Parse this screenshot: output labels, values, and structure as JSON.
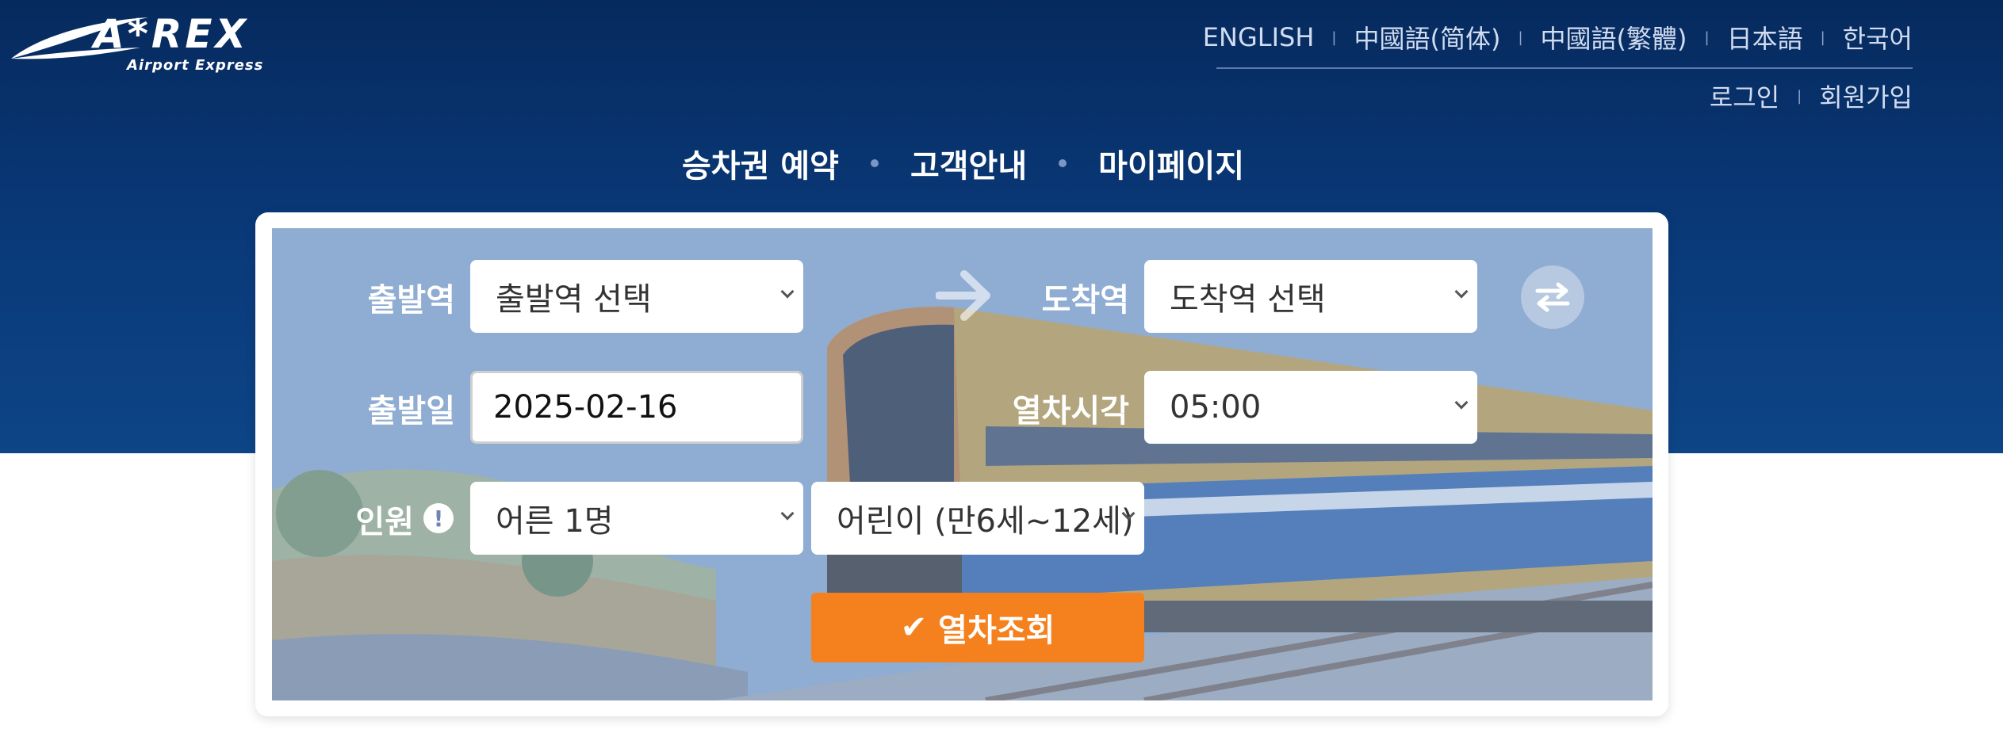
{
  "logo": {
    "text": "A*REX",
    "subtitle": "Airport Express"
  },
  "languages": [
    "ENGLISH",
    "中國語(简体)",
    "中國語(繁體)",
    "日本語",
    "한국어"
  ],
  "user_links": {
    "login": "로그인",
    "signup": "회원가입"
  },
  "main_nav": [
    "승차권 예약",
    "고객안내",
    "마이페이지"
  ],
  "form": {
    "departure_label": "출발역",
    "departure_value": "출발역 선택",
    "arrival_label": "도착역",
    "arrival_value": "도착역 선택",
    "date_label": "출발일",
    "date_value": "2025-02-16",
    "time_label": "열차시각",
    "time_value": "05:00",
    "passenger_label": "인원",
    "adult_value": "어른 1명",
    "child_value": "어린이 (만6세~12세)",
    "search_label": "열차조회"
  },
  "colors": {
    "header_bg": "#0a3a7a",
    "accent": "#f4811e"
  }
}
